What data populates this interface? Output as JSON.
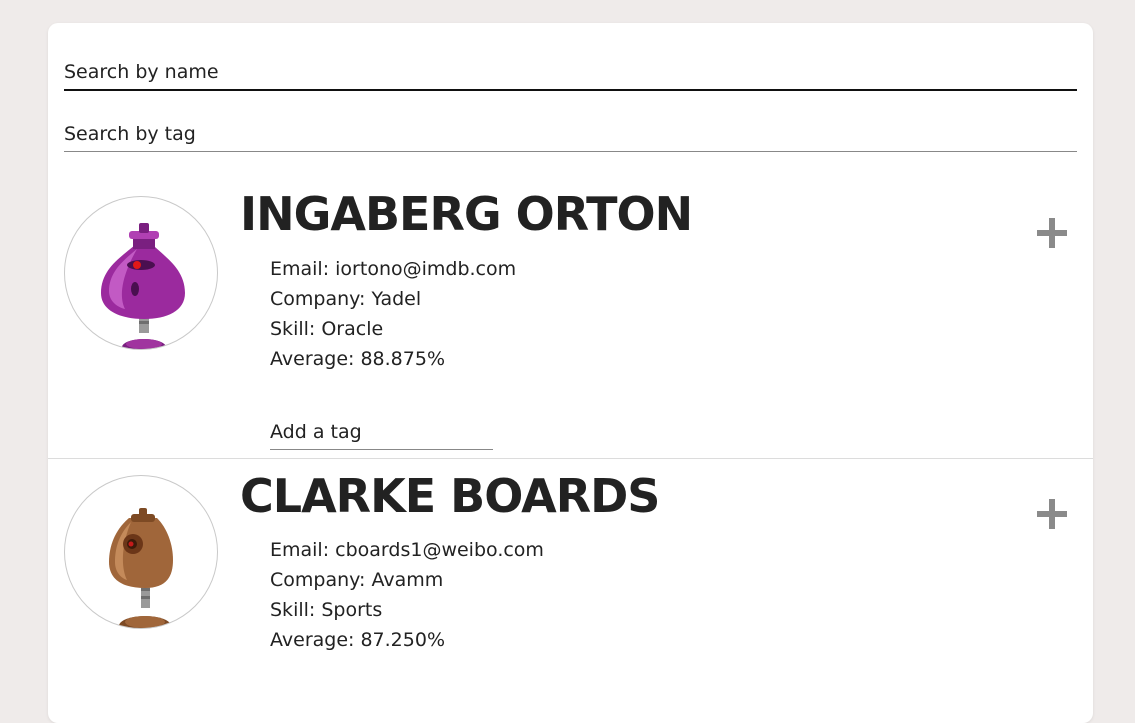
{
  "search": {
    "name_placeholder": "Search by name",
    "tag_placeholder": "Search by tag"
  },
  "students": [
    {
      "name": "INGABERG ORTON",
      "email_text": "Email: iortono@imdb.com",
      "company_text": "Company: Yadel",
      "skill_text": "Skill: Oracle",
      "average_text": "Average: 88.875%",
      "tag_placeholder": "Add a tag",
      "avatar_icon": "robot-avatar-purple",
      "avatar_color": "#9b2a9e"
    },
    {
      "name": "CLARKE BOARDS",
      "email_text": "Email: cboards1@weibo.com",
      "company_text": "Company: Avamm",
      "skill_text": "Skill: Sports",
      "average_text": "Average: 87.250%",
      "avatar_icon": "robot-avatar-brown",
      "avatar_color": "#a0663a"
    }
  ],
  "icons": {
    "expand": "plus-icon"
  },
  "colors": {
    "page_background": "#efebea",
    "card_background": "#ffffff",
    "text": "#222222",
    "plus_icon": "#8a8a8a"
  }
}
